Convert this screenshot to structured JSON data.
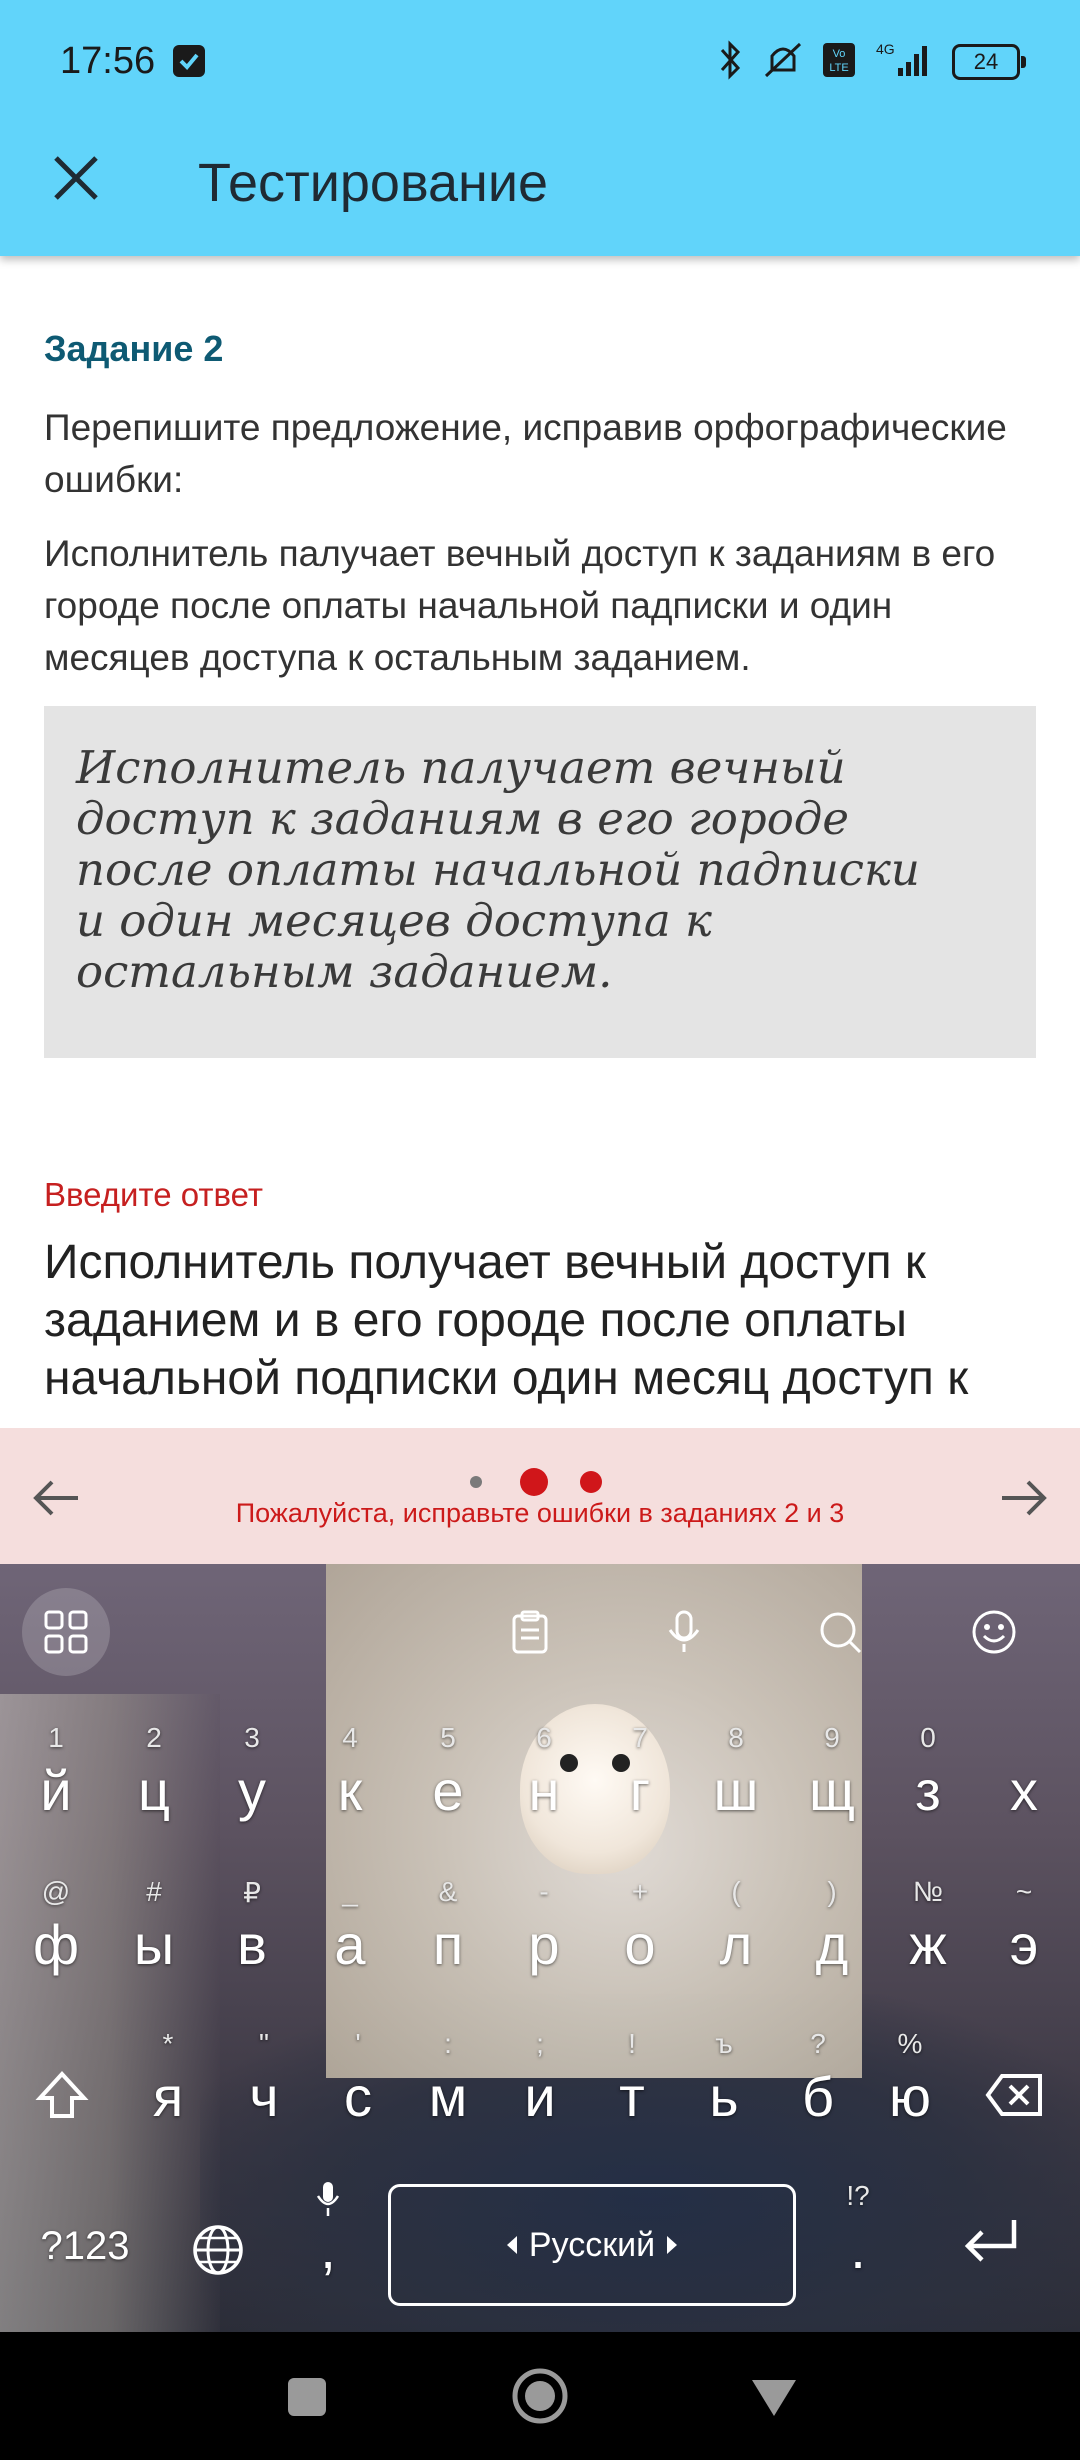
{
  "status_bar": {
    "time": "17:56",
    "battery": "24",
    "icons": [
      "check-square-icon",
      "bluetooth-icon",
      "mute-vibrate-icon",
      "volte-icon",
      "signal-4g-icon",
      "battery-icon"
    ]
  },
  "app_bar": {
    "title": "Тестирование",
    "close_icon": "close-icon"
  },
  "task": {
    "number": "Задание 2",
    "instruction": "Перепишите предложение, исправив орфографические ошибки:",
    "sentence": "Исполнитель палучает вечный доступ к заданиям в его городе после оплаты начальной падписки и один месяцев доступа к остальным заданием.",
    "image_lines": [
      "Исполнитель палучает вечный",
      "доступ к заданиям в его городе",
      "после оплаты начальной падписки",
      "и один месяцев доступа к",
      "остальным заданием."
    ]
  },
  "answer": {
    "label": "Введите ответ",
    "value": "Исполнитель получает вечный доступ к заданием и в его городе после оплаты начальной подписки один месяц доступ к"
  },
  "navigation": {
    "message": "Пожалуйста, исправьте ошибки в заданиях 2 и 3",
    "dots": [
      "small-gray",
      "large-red",
      "medium-red"
    ],
    "colors": {
      "strip_bg": "#f5dedd",
      "dot_active": "#d0161a",
      "dot_inactive": "#7a7a7a"
    }
  },
  "keyboard": {
    "row1": [
      {
        "hint": "1",
        "key": "й"
      },
      {
        "hint": "2",
        "key": "ц"
      },
      {
        "hint": "3",
        "key": "у"
      },
      {
        "hint": "4",
        "key": "к"
      },
      {
        "hint": "5",
        "key": "е"
      },
      {
        "hint": "6",
        "key": "н"
      },
      {
        "hint": "7",
        "key": "г"
      },
      {
        "hint": "8",
        "key": "ш"
      },
      {
        "hint": "9",
        "key": "щ"
      },
      {
        "hint": "0",
        "key": "з"
      },
      {
        "hint": "",
        "key": "х"
      }
    ],
    "row2": [
      {
        "hint": "@",
        "key": "ф"
      },
      {
        "hint": "#",
        "key": "ы"
      },
      {
        "hint": "₽",
        "key": "в"
      },
      {
        "hint": "_",
        "key": "а"
      },
      {
        "hint": "&",
        "key": "п"
      },
      {
        "hint": "-",
        "key": "р"
      },
      {
        "hint": "+",
        "key": "о"
      },
      {
        "hint": "(",
        "key": "л"
      },
      {
        "hint": ")",
        "key": "д"
      },
      {
        "hint": "№",
        "key": "ж"
      },
      {
        "hint": "~",
        "key": "э"
      }
    ],
    "row3": [
      {
        "hint": "*",
        "key": "я"
      },
      {
        "hint": "\"",
        "key": "ч"
      },
      {
        "hint": "'",
        "key": "с"
      },
      {
        "hint": ":",
        "key": "м"
      },
      {
        "hint": ";",
        "key": "и"
      },
      {
        "hint": "!",
        "key": "т"
      },
      {
        "hint": "ъ",
        "key": "ь"
      },
      {
        "hint": "?",
        "key": "б"
      },
      {
        "hint": "%",
        "key": "ю"
      }
    ],
    "symbols_key": "?123",
    "comma_key": ",",
    "period_key": ".",
    "period_hint": "!?",
    "space_label": "Русский",
    "toolbar_icons": [
      "grid-icon",
      "clipboard-icon",
      "microphone-icon",
      "search-icon",
      "emoji-icon"
    ]
  }
}
